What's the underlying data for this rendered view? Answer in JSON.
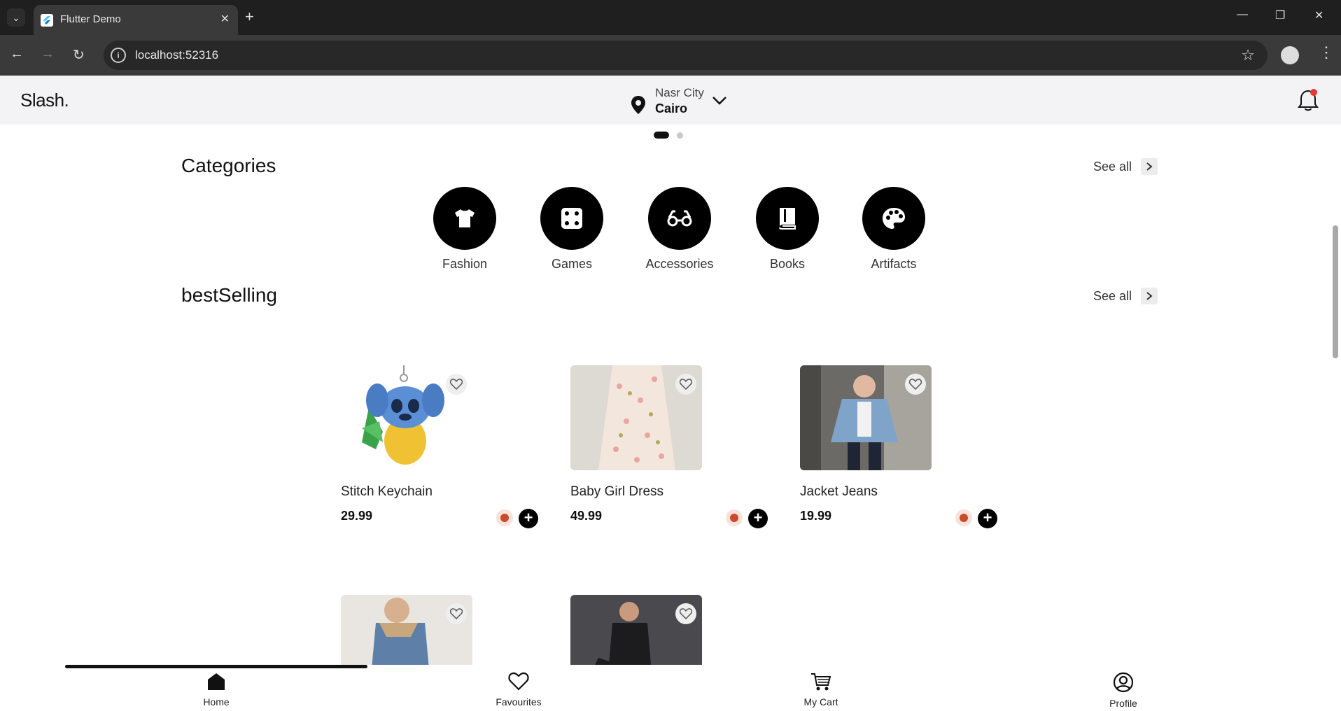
{
  "browser": {
    "tab_title": "Flutter Demo",
    "url": "localhost:52316"
  },
  "header": {
    "logo": "Slash.",
    "location_area": "Nasr City",
    "location_city": "Cairo"
  },
  "categories": {
    "title": "Categories",
    "see_all": "See all",
    "items": [
      {
        "label": "Fashion",
        "icon": "tshirt-icon"
      },
      {
        "label": "Games",
        "icon": "dice-icon"
      },
      {
        "label": "Accessories",
        "icon": "glasses-icon"
      },
      {
        "label": "Books",
        "icon": "book-icon"
      },
      {
        "label": "Artifacts",
        "icon": "palette-icon"
      }
    ]
  },
  "best_selling": {
    "title": "bestSelling",
    "see_all": "See all",
    "products": [
      {
        "name": "Stitch Keychain",
        "price": "29.99"
      },
      {
        "name": "Baby Girl Dress",
        "price": "49.99"
      },
      {
        "name": "Jacket Jeans",
        "price": "19.99"
      },
      {
        "name": "",
        "price": ""
      },
      {
        "name": "",
        "price": ""
      }
    ]
  },
  "bottom_nav": {
    "items": [
      {
        "label": "Home",
        "icon": "home-icon"
      },
      {
        "label": "Favourites",
        "icon": "heart-icon"
      },
      {
        "label": "My Cart",
        "icon": "cart-icon"
      },
      {
        "label": "Profile",
        "icon": "profile-icon"
      }
    ]
  },
  "colors": {
    "accent": "#000000",
    "notification": "#e53935",
    "header_bg": "#f3f3f5"
  }
}
